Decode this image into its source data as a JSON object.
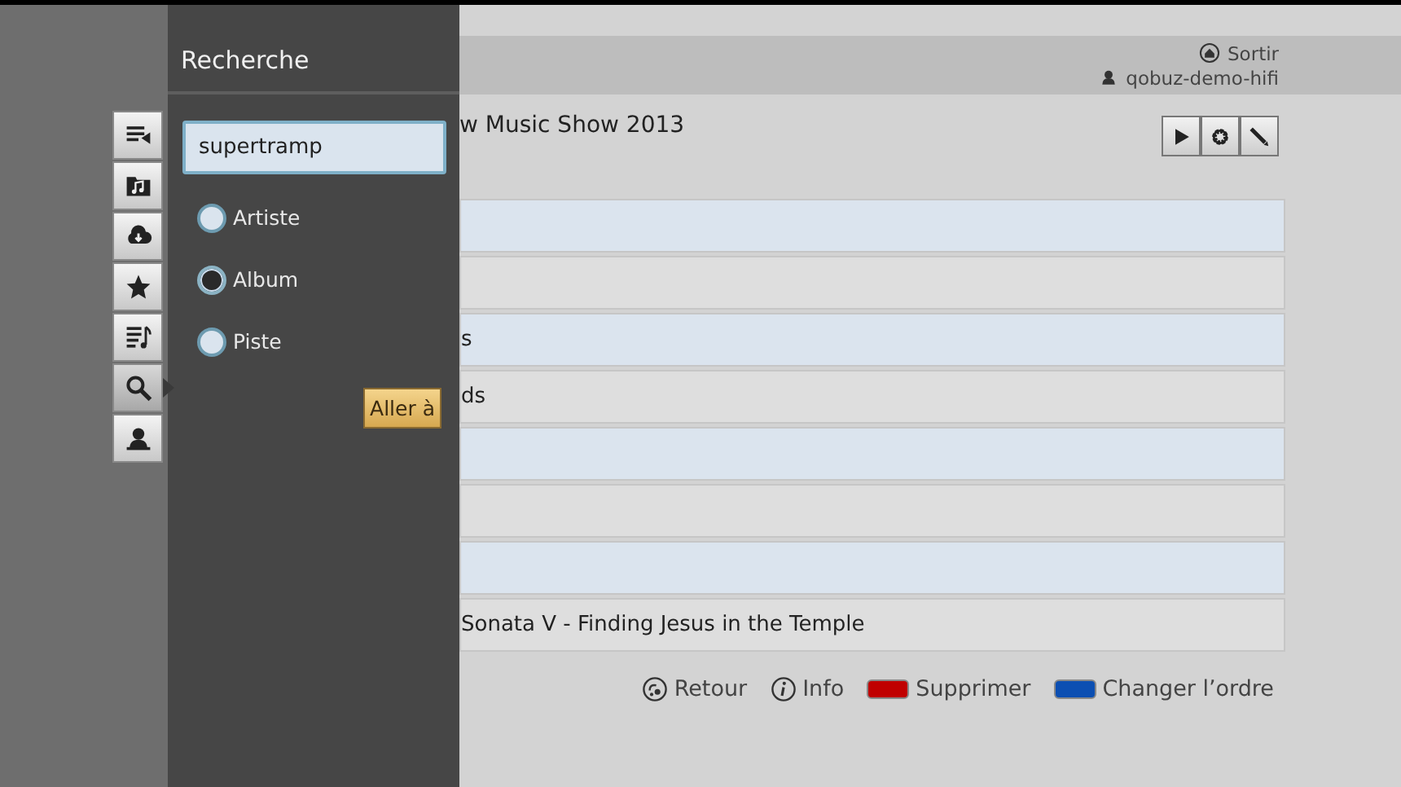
{
  "panel": {
    "title": "Recherche",
    "search": {
      "value": "supertramp"
    },
    "options": [
      {
        "label": "Artiste",
        "selected": false
      },
      {
        "label": "Album",
        "selected": true
      },
      {
        "label": "Piste",
        "selected": false
      }
    ],
    "go_button": "Aller à"
  },
  "nav": [
    {
      "kind": "queue",
      "selected": false
    },
    {
      "kind": "folder",
      "selected": false
    },
    {
      "kind": "cloud",
      "selected": false
    },
    {
      "kind": "star",
      "selected": false
    },
    {
      "kind": "playlist",
      "selected": false
    },
    {
      "kind": "search",
      "selected": true
    },
    {
      "kind": "user",
      "selected": false
    }
  ],
  "header": {
    "exit": "Sortir",
    "user": "qobuz-demo-hifi"
  },
  "title": "w Music Show 2013",
  "rows": [
    {},
    {},
    {
      "text": "s"
    },
    {
      "text": "ds"
    },
    {},
    {},
    {},
    {
      "text": "Sonata V - Finding Jesus in the Temple"
    }
  ],
  "footer": [
    {
      "kind": "back",
      "label": "Retour"
    },
    {
      "kind": "info",
      "label": "Info"
    },
    {
      "kind": "red",
      "label": "Supprimer"
    },
    {
      "kind": "blue",
      "label": "Changer l’ordre"
    }
  ]
}
